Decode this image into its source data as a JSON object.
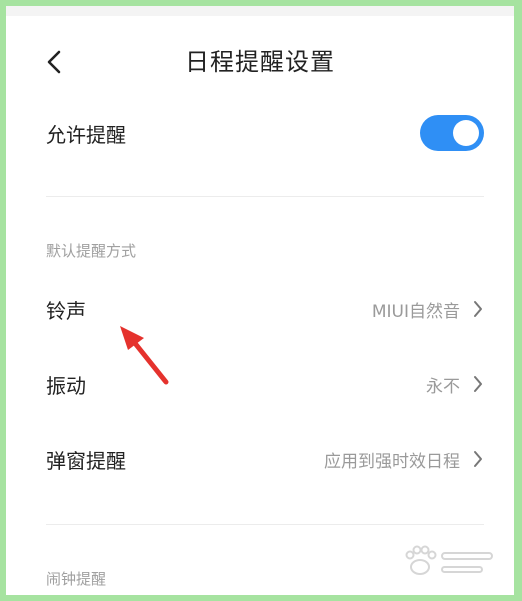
{
  "header": {
    "title": "日程提醒设置"
  },
  "allow_reminder": {
    "label": "允许提醒",
    "enabled": true
  },
  "sections": {
    "default_method": "默认提醒方式",
    "alarm": "闹钟提醒"
  },
  "rows": [
    {
      "label": "铃声",
      "value": "MIUI自然音"
    },
    {
      "label": "振动",
      "value": "永不"
    },
    {
      "label": "弹窗提醒",
      "value": "应用到强时效日程"
    }
  ],
  "colors": {
    "toggle_on": "#2f8ff5",
    "annotation_arrow": "#e5322d",
    "frame_border": "#a6e3a0"
  },
  "icons": {
    "back": "back-chevron-icon",
    "row_chevron": "chevron-right-icon",
    "annotation": "red-arrow-annotation",
    "watermark": "paw-print-watermark"
  }
}
